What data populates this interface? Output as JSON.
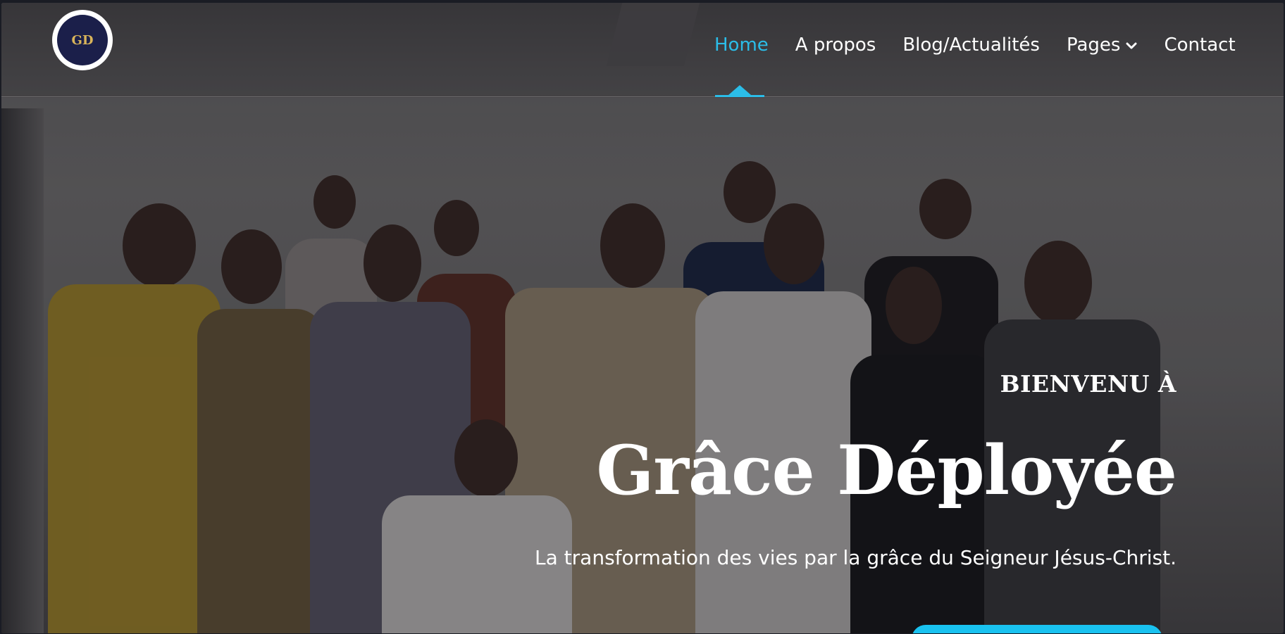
{
  "logo": {
    "text": "GD"
  },
  "nav": {
    "items": [
      {
        "label": "Home",
        "active": true
      },
      {
        "label": "A propos",
        "active": false
      },
      {
        "label": "Blog/Actualités",
        "active": false
      },
      {
        "label": "Pages",
        "active": false,
        "has_dropdown": true
      },
      {
        "label": "Contact",
        "active": false
      }
    ]
  },
  "hero": {
    "welcome": "BIENVENU À",
    "title": "Grâce Déployée",
    "subtitle": "La transformation des vies par la grâce du Seigneur Jésus-Christ."
  },
  "colors": {
    "accent": "#2bbde8",
    "cta": "#19c2f0",
    "text": "#ffffff"
  }
}
